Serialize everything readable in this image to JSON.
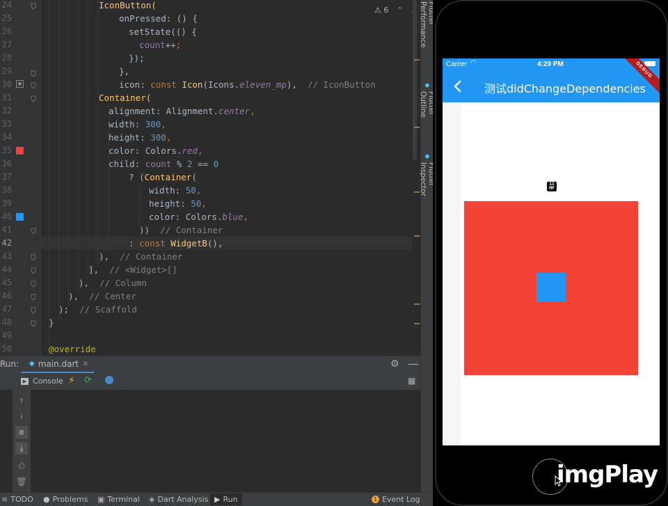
{
  "ide": {
    "warnings": {
      "icon": "warning-icon",
      "count": "6"
    },
    "line_numbers": [
      "24",
      "25",
      "26",
      "27",
      "28",
      "29",
      "30",
      "31",
      "32",
      "33",
      "34",
      "35",
      "36",
      "37",
      "38",
      "39",
      "40",
      "41",
      "42",
      "43",
      "44",
      "45",
      "46",
      "47",
      "48",
      "49",
      "50"
    ],
    "code": {
      "l24": "IconButton(",
      "l25_a": "onPressed",
      "l25_b": ": () {",
      "l26": "setState(() {",
      "l27_a": "count",
      "l27_b": "++",
      "l27_c": ";",
      "l28": "});",
      "l29": "},",
      "l30_a": "icon",
      "l30_b": ": ",
      "l30_c": "const ",
      "l30_d": "Icon",
      "l30_e": "(Icons.",
      "l30_f": "eleven_mp",
      "l30_g": "),",
      "l30_h": "  // IconButton",
      "l31": "Container(",
      "l32_a": "alignment",
      "l32_b": ": Alignment.",
      "l32_c": "center",
      "l32_d": ",",
      "l33_a": "width",
      "l33_b": ": ",
      "l33_c": "300",
      "l33_d": ",",
      "l34_a": "height",
      "l34_b": ": ",
      "l34_c": "300",
      "l34_d": ",",
      "l35_a": "color",
      "l35_b": ": Colors.",
      "l35_c": "red",
      "l35_d": ",",
      "l36_a": "child",
      "l36_b": ": ",
      "l36_c": "count",
      "l36_d": " % ",
      "l36_e": "2",
      "l36_f": " == ",
      "l36_g": "0",
      "l37_a": "? (",
      "l37_b": "Container",
      "l37_c": "(",
      "l38_a": "width",
      "l38_b": ": ",
      "l38_c": "50",
      "l38_d": ",",
      "l39_a": "height",
      "l39_b": ": ",
      "l39_c": "50",
      "l39_d": ",",
      "l40_a": "color",
      "l40_b": ": Colors.",
      "l40_c": "blue",
      "l40_d": ",",
      "l41_a": "))",
      "l41_b": "  // Container",
      "l42_a": ": ",
      "l42_b": "const ",
      "l42_c": "WidgetB",
      "l42_d": "(),",
      "l43_a": "),",
      "l43_b": "  // Container",
      "l44_a": "],",
      "l44_b": "  // <Widget>[]",
      "l45_a": "),",
      "l45_b": "  // Column",
      "l46_a": "),",
      "l46_b": "  // Center",
      "l47_a": ");",
      "l47_b": "  // Scaffold",
      "l48": "}",
      "l49": "",
      "l50": "@override"
    },
    "side_tabs": [
      "Flutter Performance",
      "Flutter Outline",
      "Flutter Inspector"
    ],
    "run_bar": {
      "label": "Run:",
      "tab": "main.dart"
    },
    "console_label": "Console",
    "status_bar": {
      "todo": "TODO",
      "problems": "Problems",
      "terminal": "Terminal",
      "dart_analysis": "Dart Analysis",
      "run": "Run",
      "event_log": "Event Log",
      "event_count": "1"
    },
    "colors": {
      "gutter_red": "#f44336",
      "gutter_blue": "#2196f3"
    }
  },
  "phone": {
    "carrier": "Carrier",
    "time": "4:29 PM",
    "title": "测试didChangeDependencies",
    "debug_banner": "DEBUG",
    "icon_button": "eleven-mp-icon",
    "icon_text_top": "11",
    "icon_text_bottom": "MP",
    "colors": {
      "appbar": "#2196f3",
      "outer_container": "#f44336",
      "inner_container": "#2196f3"
    }
  },
  "watermark": "imgPlay"
}
